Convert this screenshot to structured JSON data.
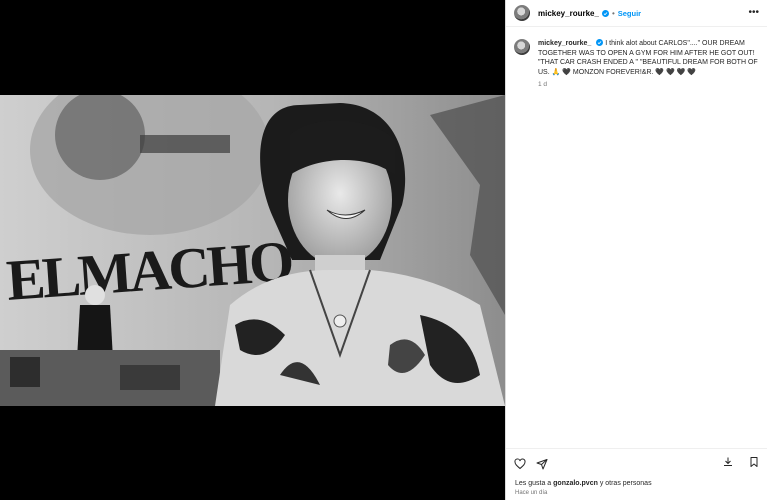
{
  "post": {
    "username": "mickey_rourke_",
    "follow_label": "Seguir",
    "more_icon": "•••",
    "caption": {
      "username": "mickey_rourke_",
      "text": "I think alot about CARLOS\"....\" OUR DREAM TOGETHER WAS TO OPEN A GYM FOR HIM AFTER HE GOT OUT! \"THAT CAR CRASH ENDED A \" \"BEAUTIFUL DREAM FOR BOTH OF US. 🙏 🖤 MONZON FOREVER!&R. 🖤 🖤 🖤 🖤",
      "time": "1 d"
    },
    "photo": {
      "poster_text": "ELMACHO"
    },
    "likes": {
      "prefix": "Les gusta a ",
      "user": "gonzalo.pvcn",
      "suffix": " y otras personas"
    },
    "ago": "Hace un día"
  },
  "icons": {
    "verified": "verified-badge-icon",
    "like": "heart-icon",
    "share": "send-icon",
    "save": "save-download-icon",
    "bookmark": "bookmark-icon"
  },
  "colors": {
    "link_blue": "#0095f6",
    "muted": "#737373"
  }
}
